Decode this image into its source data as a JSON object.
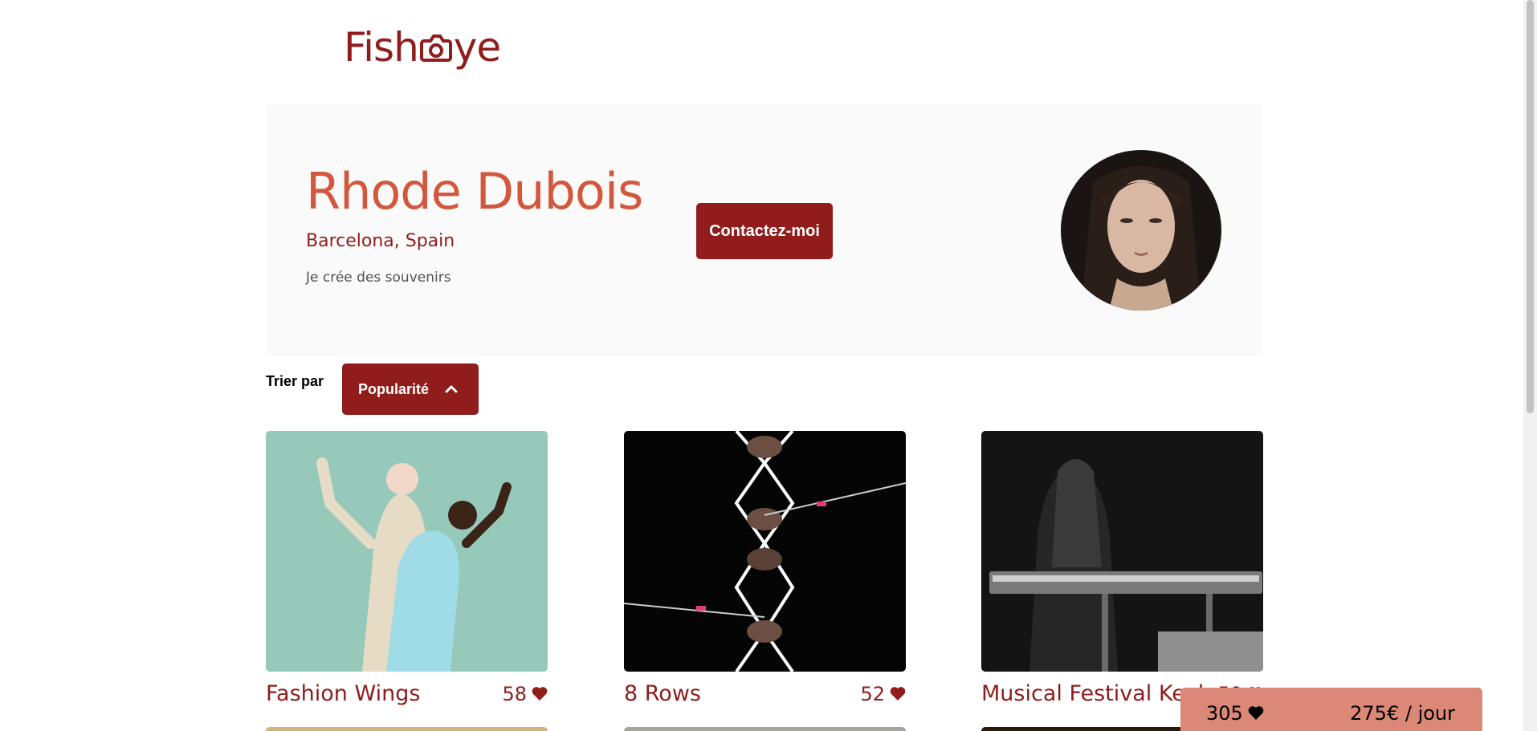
{
  "logo": {
    "text_before": "Fish",
    "icon": "camera-icon",
    "text_after": "ye"
  },
  "photographer": {
    "name": "Rhode Dubois",
    "location": "Barcelona, Spain",
    "tagline": "Je crée des souvenirs",
    "contact_label": "Contactez-moi"
  },
  "sort": {
    "label": "Trier par",
    "selected": "Popularité",
    "icon": "chevron-up-icon"
  },
  "media": [
    {
      "title": "Fashion Wings",
      "likes": "58"
    },
    {
      "title": "8 Rows",
      "likes": "52"
    },
    {
      "title": "Musical Festival Keyb",
      "likes": "50"
    }
  ],
  "stats": {
    "total_likes": "305",
    "price": "275€ / jour"
  },
  "colors": {
    "primary": "#901C1C",
    "secondary": "#D3573C",
    "stats_bg": "#DB8876",
    "header_bg": "#FAFAFA"
  }
}
